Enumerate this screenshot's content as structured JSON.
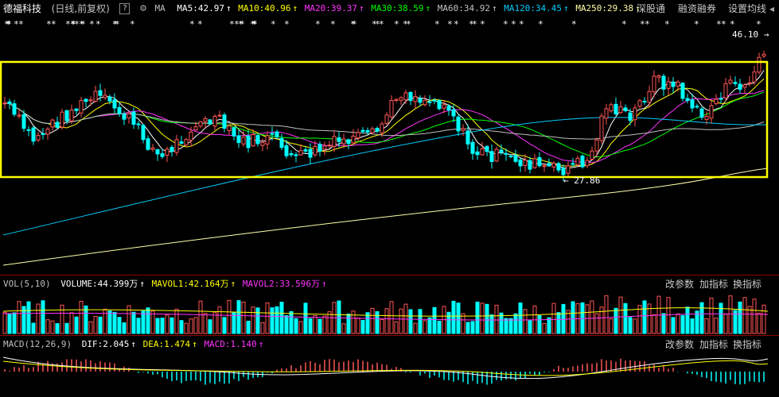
{
  "header": {
    "stock_name": "德福科技",
    "period": "(日线,前复权)",
    "help_label": "?",
    "ma_label": "MA",
    "ma_items": [
      {
        "label": "MA5:42.97",
        "color": "#ffffff"
      },
      {
        "label": "MA10:40.96",
        "color": "#ffff00"
      },
      {
        "label": "MA20:39.37",
        "color": "#ff33ff"
      },
      {
        "label": "MA30:38.59",
        "color": "#00ff00"
      },
      {
        "label": "MA60:34.92",
        "color": "#c0c0c0"
      },
      {
        "label": "MA120:34.45",
        "color": "#00ccff"
      },
      {
        "label": "MA250:29.38",
        "color": "#ffffaa"
      }
    ],
    "buttons": [
      "深股通",
      "融资融券",
      "设置均线"
    ],
    "collapse_arrow": "◂"
  },
  "price_panel": {
    "high_label": "46.10",
    "low_label": "27.86"
  },
  "volume_panel": {
    "indicator": "VOL(5,10)",
    "volume": "VOLUME:44.399万",
    "mavol1": "MAVOL1:42.164万",
    "mavol2": "MAVOL2:33.596万",
    "buttons": [
      "改参数",
      "加指标",
      "换指标"
    ]
  },
  "macd_panel": {
    "indicator": "MACD(12,26,9)",
    "dif": "DIF:2.045",
    "dea": "DEA:1.474",
    "macd": "MACD:1.140",
    "buttons": [
      "改参数",
      "加指标",
      "换指标"
    ]
  },
  "colors": {
    "up": "#ff5555",
    "down": "#00ffff",
    "box": "#ffff00",
    "ma5": "#ffffff",
    "ma10": "#ffff00",
    "ma20": "#ff33ff",
    "ma30": "#00ff00",
    "ma60": "#c0c0c0",
    "ma120": "#00ccff",
    "ma250": "#ffffaa"
  }
}
